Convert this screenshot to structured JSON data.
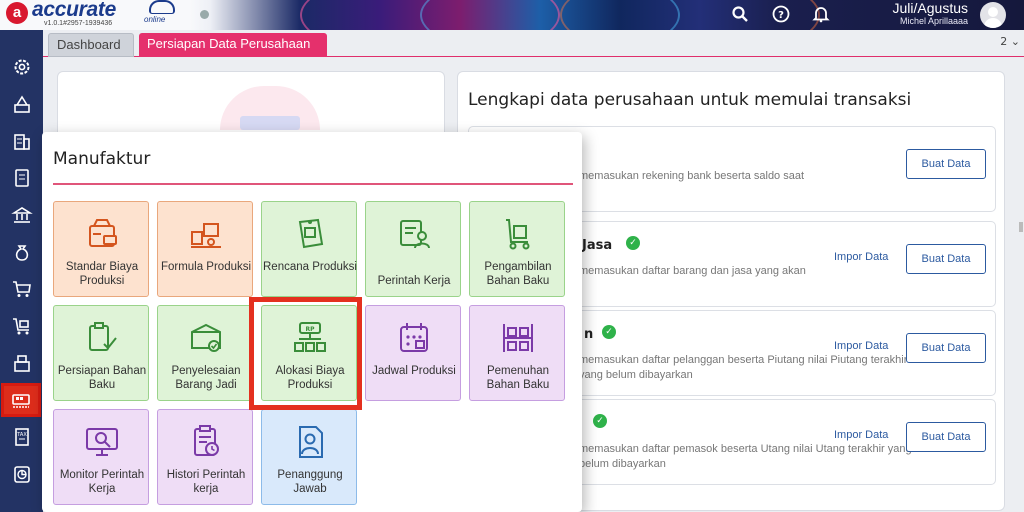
{
  "app": {
    "logo_letter": "a",
    "logo_word": "accurate",
    "logo_suffix": "online",
    "version": "v1.0.1#2957-1939436"
  },
  "header": {
    "period": "Juli/Agustus",
    "user": "Michel Aprillaaaa",
    "icons": [
      "search-icon",
      "help-icon",
      "bell-icon",
      "avatar"
    ]
  },
  "sidebar": {
    "items": [
      {
        "icon": "settings-icon"
      },
      {
        "icon": "company-icon"
      },
      {
        "icon": "building-icon"
      },
      {
        "icon": "ledger-icon"
      },
      {
        "icon": "bank-icon"
      },
      {
        "icon": "money-bag-icon"
      },
      {
        "icon": "cart-icon"
      },
      {
        "icon": "cart-box-icon"
      },
      {
        "icon": "inventory-icon"
      },
      {
        "icon": "manufacturing-icon",
        "active": true
      },
      {
        "icon": "tax-icon"
      },
      {
        "icon": "report-icon"
      }
    ]
  },
  "tabs": {
    "items": [
      {
        "label": "Dashboard",
        "active": false
      },
      {
        "label": "Persiapan Data Perusahaan",
        "active": true
      }
    ],
    "count": "2 ⌄"
  },
  "right_panel": {
    "title": "Lengkapi data perusahaan untuk memulai transaksi",
    "tasks": [
      {
        "title": "nk",
        "desc": "memasukan rekening bank beserta saldo saat",
        "completed": false,
        "has_import": false,
        "create": "Buat Data"
      },
      {
        "title": "Jasa",
        "desc": "memasukan daftar barang dan jasa yang akan",
        "completed": true,
        "has_import": true,
        "import": "Impor Data",
        "create": "Buat Data"
      },
      {
        "title": "n",
        "desc": "memasukan daftar pelanggan beserta Piutang nilai Piutang terakhir yang belum dibayarkan",
        "completed": true,
        "has_import": true,
        "import": "Impor Data",
        "create": "Buat Data"
      },
      {
        "title": "",
        "desc": "memasukan daftar pemasok beserta Utang nilai Utang terakhir yang belum dibayarkan",
        "completed": true,
        "has_import": true,
        "import": "Impor Data",
        "create": "Buat Data"
      }
    ]
  },
  "popup": {
    "title": "Manufaktur",
    "items": [
      {
        "label": "Standar Biaya Produksi",
        "color": "orange",
        "icon": "cost-standard-icon"
      },
      {
        "label": "Formula Produksi",
        "color": "orange",
        "icon": "formula-icon"
      },
      {
        "label": "Rencana Produksi",
        "color": "green",
        "icon": "production-plan-icon"
      },
      {
        "label": "Perintah Kerja",
        "color": "green",
        "icon": "work-order-icon"
      },
      {
        "label": "Pengambilan Bahan Baku",
        "color": "green",
        "icon": "material-pick-icon"
      },
      {
        "label": "Persiapan Bahan Baku",
        "color": "green",
        "icon": "material-prep-icon"
      },
      {
        "label": "Penyelesaian Barang Jadi",
        "color": "green",
        "icon": "finished-goods-icon"
      },
      {
        "label": "Alokasi Biaya Produksi",
        "color": "green",
        "icon": "cost-allocation-icon",
        "highlighted": true
      },
      {
        "label": "Jadwal Produksi",
        "color": "purple",
        "icon": "schedule-icon"
      },
      {
        "label": "Pemenuhan Bahan Baku",
        "color": "purple",
        "icon": "material-fulfill-icon"
      },
      {
        "label": "Monitor Perintah Kerja",
        "color": "purple",
        "icon": "monitor-icon"
      },
      {
        "label": "Histori Perintah kerja",
        "color": "purple",
        "icon": "history-icon"
      },
      {
        "label": "Penanggung Jawab",
        "color": "blue",
        "icon": "person-in-charge-icon"
      }
    ]
  },
  "colors": {
    "accent": "#e5306c",
    "sidebar": "#233364",
    "highlight": "#e4301f",
    "link": "#2c5aa0"
  }
}
